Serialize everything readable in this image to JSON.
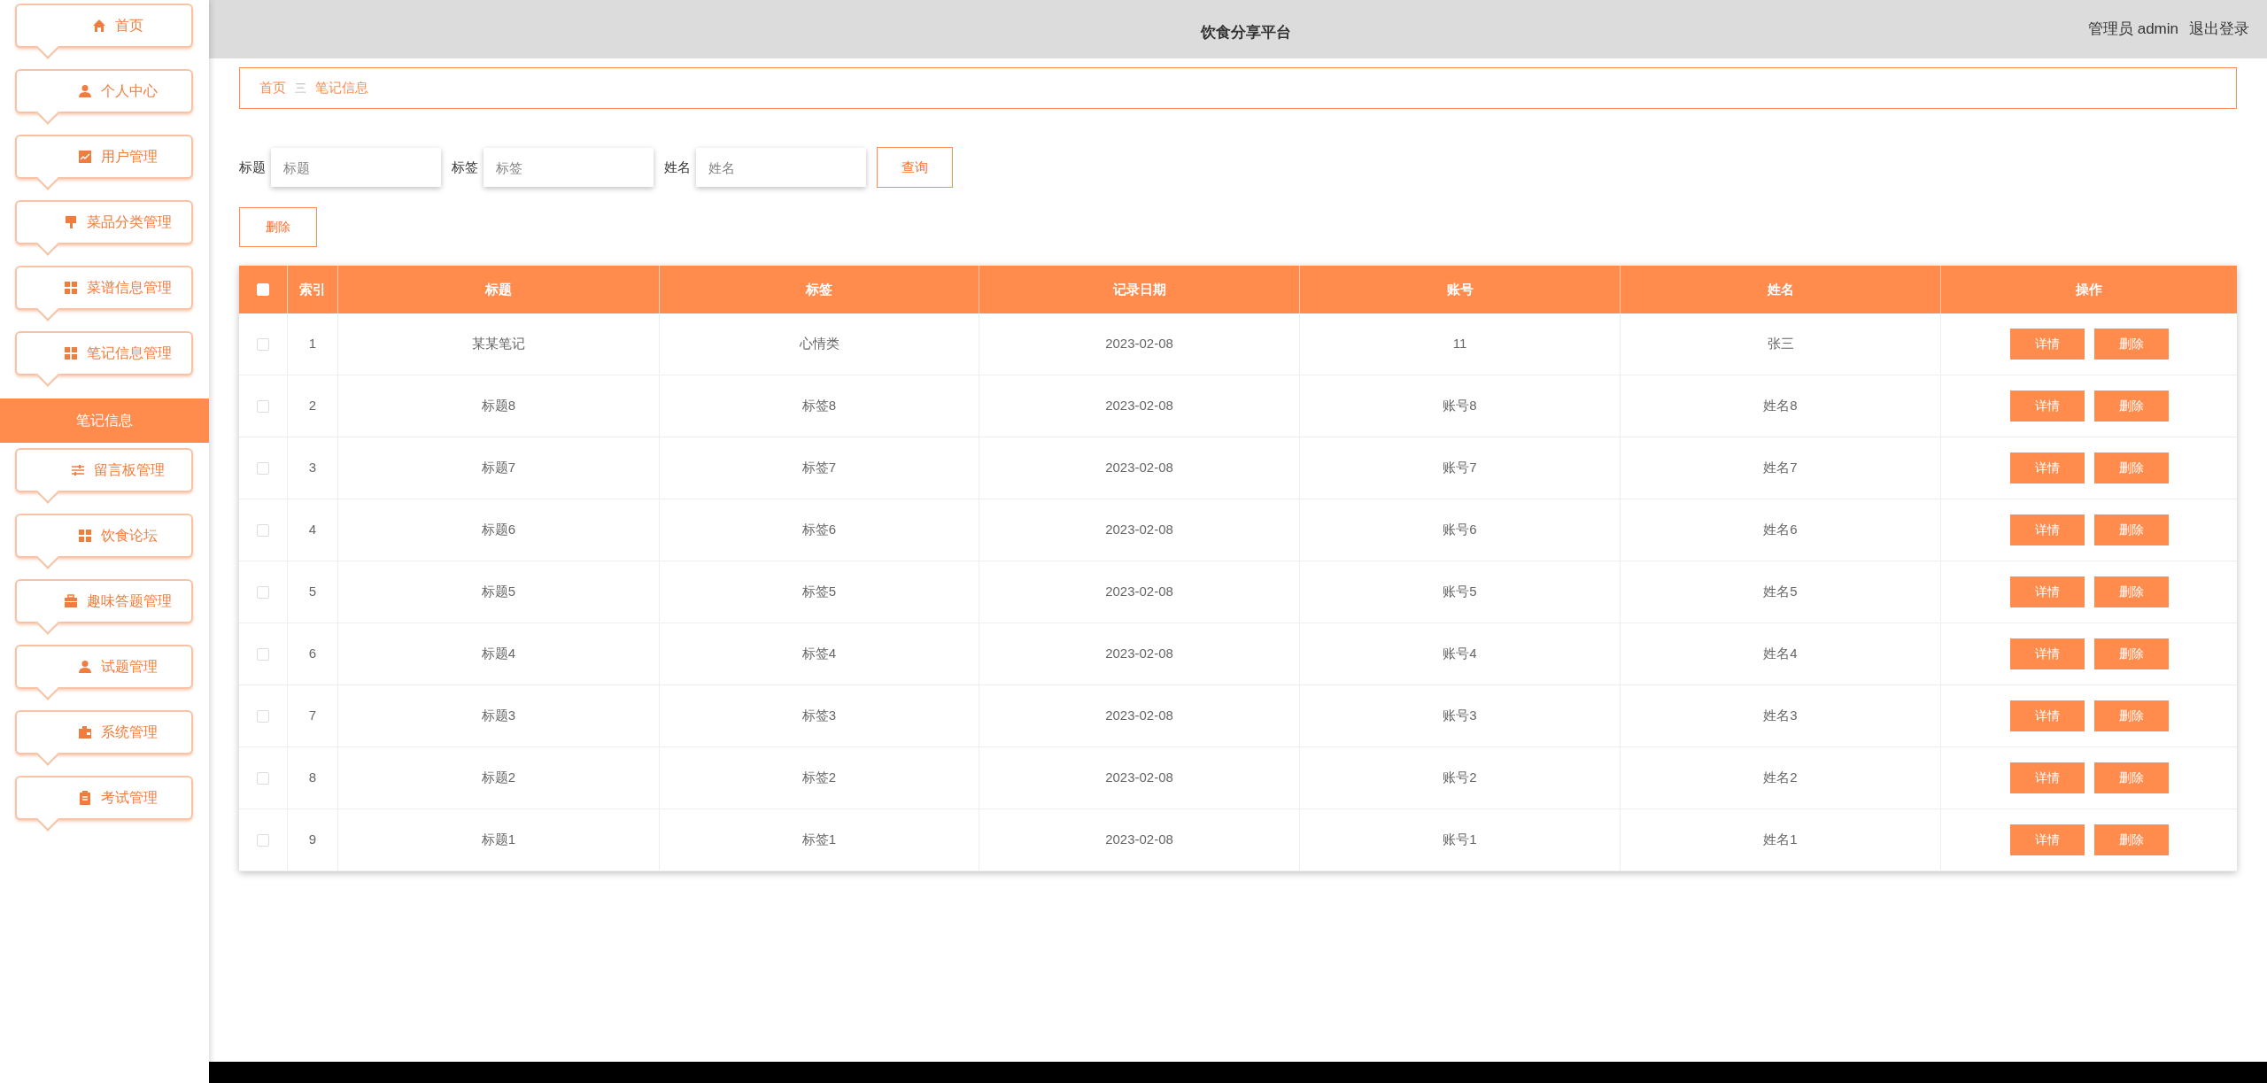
{
  "header": {
    "title": "饮食分享平台",
    "user": "管理员 admin",
    "logout": "退出登录"
  },
  "sidebar": {
    "items": [
      {
        "label": "首页",
        "selected": false
      },
      {
        "label": "个人中心",
        "selected": false
      },
      {
        "label": "用户管理",
        "selected": false
      },
      {
        "label": "菜品分类管理",
        "selected": false
      },
      {
        "label": "菜谱信息管理",
        "selected": false
      },
      {
        "label": "笔记信息管理",
        "selected": false
      },
      {
        "label": "笔记信息",
        "selected": true
      },
      {
        "label": "留言板管理",
        "selected": false
      },
      {
        "label": "饮食论坛",
        "selected": false
      },
      {
        "label": "趣味答题管理",
        "selected": false
      },
      {
        "label": "试题管理",
        "selected": false
      },
      {
        "label": "系统管理",
        "selected": false
      },
      {
        "label": "考试管理",
        "selected": false
      }
    ]
  },
  "breadcrumb": {
    "home": "首页",
    "separator": "三",
    "current": "笔记信息"
  },
  "search": {
    "fields": [
      {
        "label": "标题",
        "placeholder": "标题"
      },
      {
        "label": "标签",
        "placeholder": "标签"
      },
      {
        "label": "姓名",
        "placeholder": "姓名"
      }
    ],
    "button": "查询"
  },
  "delete_button": "删除",
  "table": {
    "select_all": {
      "checked": false
    },
    "columns": [
      "索引",
      "标题",
      "标签",
      "记录日期",
      "账号",
      "姓名",
      "操作"
    ],
    "rows": [
      {
        "checked": false,
        "cells": [
          "1",
          "某某笔记",
          "心情类",
          "2023-02-08",
          "11",
          "张三"
        ],
        "actions": [
          "详情",
          "删除"
        ]
      },
      {
        "checked": false,
        "cells": [
          "2",
          "标题8",
          "标签8",
          "2023-02-08",
          "账号8",
          "姓名8"
        ],
        "actions": [
          "详情",
          "删除"
        ]
      },
      {
        "checked": false,
        "cells": [
          "3",
          "标题7",
          "标签7",
          "2023-02-08",
          "账号7",
          "姓名7"
        ],
        "actions": [
          "详情",
          "删除"
        ]
      },
      {
        "checked": false,
        "cells": [
          "4",
          "标题6",
          "标签6",
          "2023-02-08",
          "账号6",
          "姓名6"
        ],
        "actions": [
          "详情",
          "删除"
        ]
      },
      {
        "checked": false,
        "cells": [
          "5",
          "标题5",
          "标签5",
          "2023-02-08",
          "账号5",
          "姓名5"
        ],
        "actions": [
          "详情",
          "删除"
        ]
      },
      {
        "checked": false,
        "cells": [
          "6",
          "标题4",
          "标签4",
          "2023-02-08",
          "账号4",
          "姓名4"
        ],
        "actions": [
          "详情",
          "删除"
        ]
      },
      {
        "checked": false,
        "cells": [
          "7",
          "标题3",
          "标签3",
          "2023-02-08",
          "账号3",
          "姓名3"
        ],
        "actions": [
          "详情",
          "删除"
        ]
      },
      {
        "checked": false,
        "cells": [
          "8",
          "标题2",
          "标签2",
          "2023-02-08",
          "账号2",
          "姓名2"
        ],
        "actions": [
          "详情",
          "删除"
        ]
      },
      {
        "checked": false,
        "cells": [
          "9",
          "标题1",
          "标签1",
          "2023-02-08",
          "账号1",
          "姓名1"
        ],
        "actions": [
          "详情",
          "删除"
        ]
      }
    ]
  }
}
